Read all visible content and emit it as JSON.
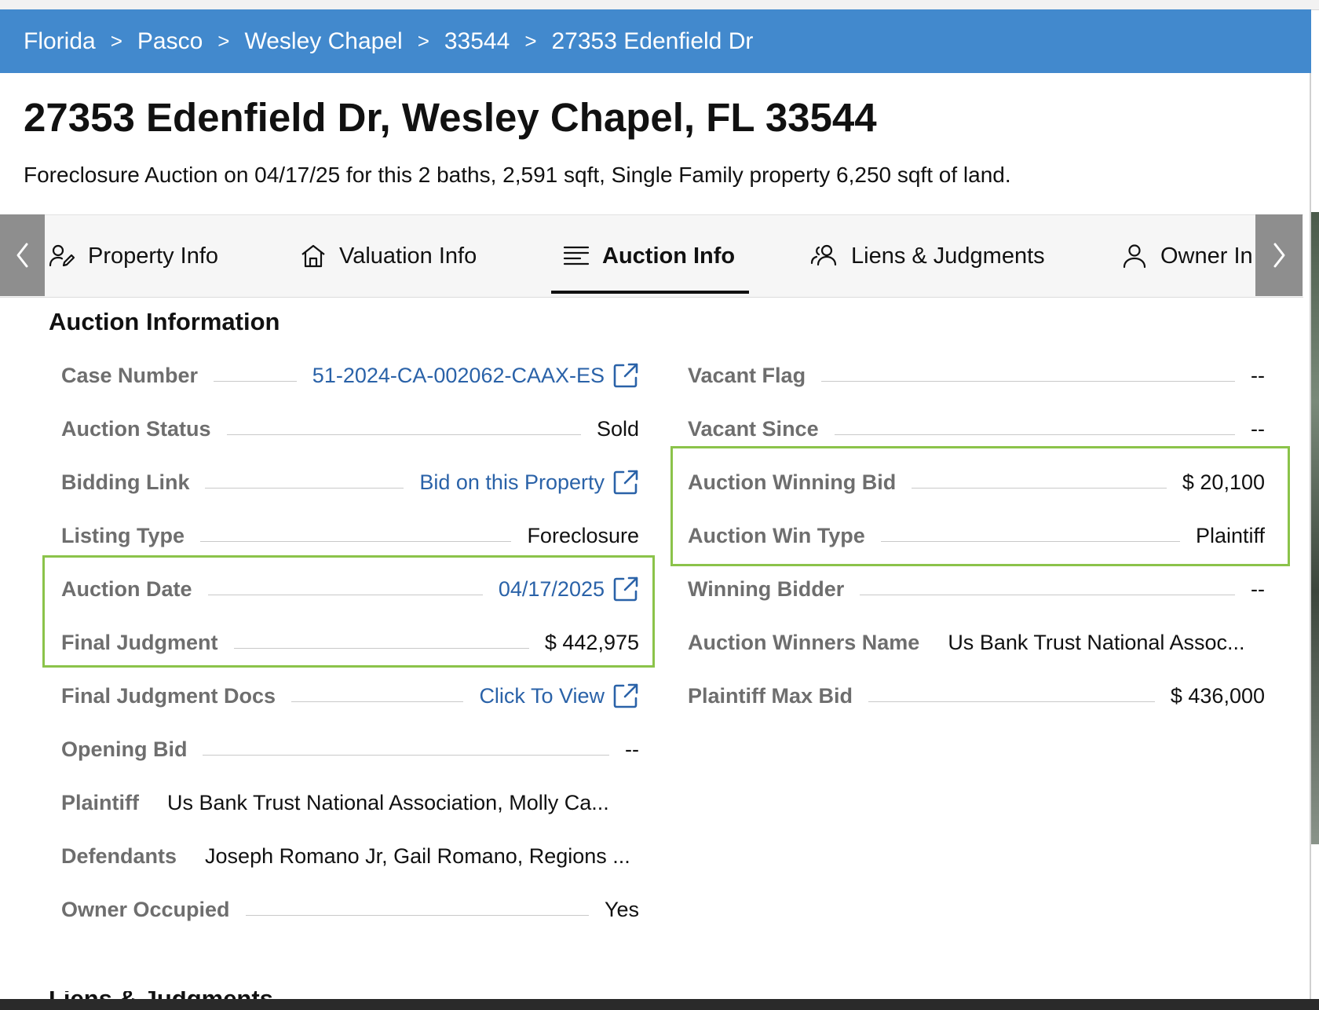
{
  "breadcrumb": [
    "Florida",
    "Pasco",
    "Wesley Chapel",
    "33544",
    "27353 Edenfield Dr"
  ],
  "breadcrumb_separator": ">",
  "page": {
    "title": "27353 Edenfield Dr, Wesley Chapel, FL 33544",
    "subtitle": "Foreclosure Auction on 04/17/25 for this 2 baths, 2,591 sqft, Single Family property 6,250 sqft of land."
  },
  "tabs": {
    "items": [
      {
        "label": "Property Info",
        "icon": "person-edit-icon"
      },
      {
        "label": "Valuation Info",
        "icon": "home-icon"
      },
      {
        "label": "Auction Info",
        "icon": "lines-icon"
      },
      {
        "label": "Liens & Judgments",
        "icon": "people-icon"
      },
      {
        "label": "Owner In",
        "icon": "person-icon"
      }
    ],
    "active": "Auction Info"
  },
  "section": {
    "title": "Auction Information",
    "next_section_title": "Liens & Judgments"
  },
  "left": {
    "case_number": {
      "label": "Case Number",
      "value": "51-2024-CA-002062-CAAX-ES"
    },
    "auction_status": {
      "label": "Auction Status",
      "value": "Sold"
    },
    "bidding_link": {
      "label": "Bidding Link",
      "value": "Bid on this Property"
    },
    "listing_type": {
      "label": "Listing Type",
      "value": "Foreclosure"
    },
    "auction_date": {
      "label": "Auction Date",
      "value": "04/17/2025"
    },
    "final_judgment": {
      "label": "Final Judgment",
      "value": "$ 442,975"
    },
    "final_judgment_docs": {
      "label": "Final Judgment Docs",
      "value": "Click To View"
    },
    "opening_bid": {
      "label": "Opening Bid",
      "value": "--"
    },
    "plaintiff": {
      "label": "Plaintiff",
      "value": "Us Bank Trust National Association, Molly Ca..."
    },
    "defendants": {
      "label": "Defendants",
      "value": "Joseph Romano Jr, Gail Romano, Regions ..."
    },
    "owner_occupied": {
      "label": "Owner Occupied",
      "value": "Yes"
    }
  },
  "right": {
    "vacant_flag": {
      "label": "Vacant Flag",
      "value": "--"
    },
    "vacant_since": {
      "label": "Vacant Since",
      "value": "--"
    },
    "auction_winning_bid": {
      "label": "Auction Winning Bid",
      "value": "$ 20,100"
    },
    "auction_win_type": {
      "label": "Auction Win Type",
      "value": "Plaintiff"
    },
    "winning_bidder": {
      "label": "Winning Bidder",
      "value": "--"
    },
    "auction_winners_name": {
      "label": "Auction Winners Name",
      "value": "Us Bank Trust National Assoc..."
    },
    "plaintiff_max_bid": {
      "label": "Plaintiff Max Bid",
      "value": "$ 436,000"
    }
  },
  "colors": {
    "breadcrumb_bg": "#4289cd",
    "link": "#2a62a8",
    "highlight_border": "#8bc34a",
    "label": "#6e6e6e"
  }
}
